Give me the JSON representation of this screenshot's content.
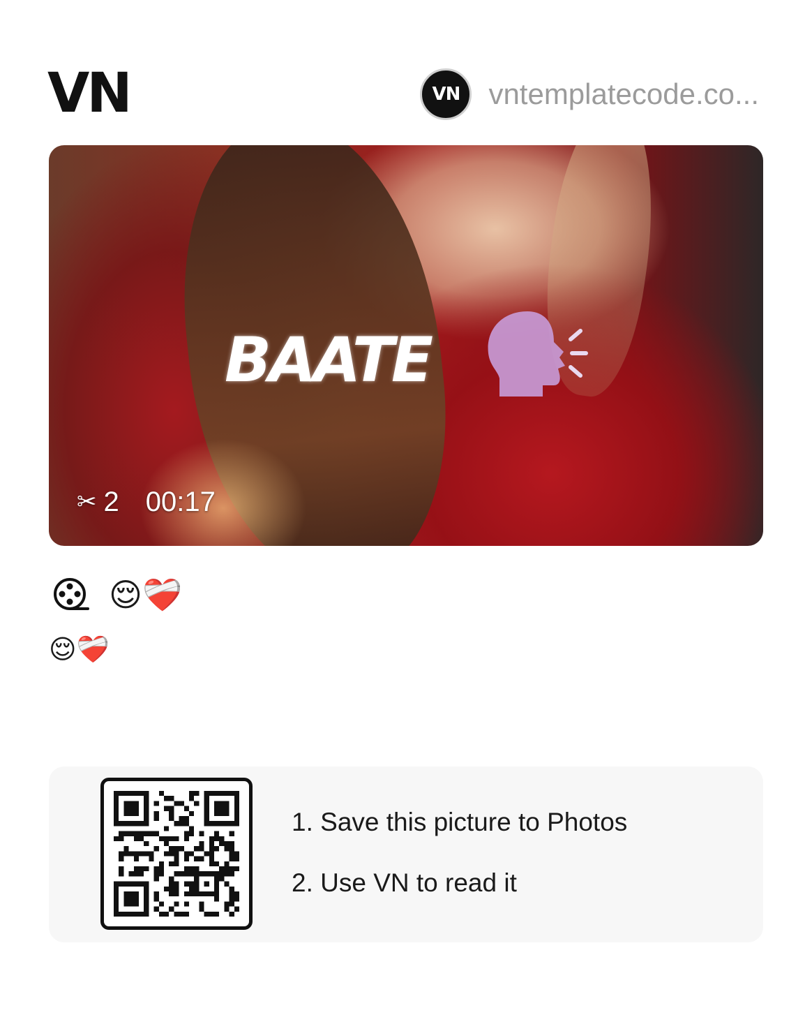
{
  "header": {
    "logo_text": "VN",
    "avatar_text": "VN",
    "author_name": "vntemplatecode.co..."
  },
  "cover": {
    "overlay_title": "BAATE",
    "overlay_icon": "speaking-head-icon",
    "clip_icon": "scissors-icon",
    "clip_count": "2",
    "duration": "00:17"
  },
  "template": {
    "type_icon": "film-reel-icon",
    "title": "😌❤️‍🩹",
    "description": "😌❤️‍🩹"
  },
  "qr_panel": {
    "qr_icon": "qr-code-icon",
    "step1": "1. Save this picture to Photos",
    "step2": "2. Use VN to read it"
  },
  "colors": {
    "background": "#ffffff",
    "panel": "#f7f7f7",
    "author_text": "#9b9b9b"
  }
}
